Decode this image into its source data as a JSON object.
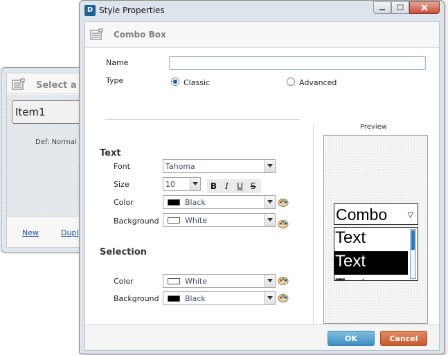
{
  "background_window": {
    "title": "Select a S",
    "list_item": "Item1",
    "default_text": "Def: Normal",
    "links": {
      "new": "New",
      "duplicate": "Dupl"
    }
  },
  "dialog": {
    "app_icon_label": "D",
    "title": "Style Properties",
    "header_title": "Combo Box",
    "name_label": "Name",
    "name_value": "",
    "type_label": "Type",
    "type_options": {
      "classic": "Classic",
      "advanced": "Advanced"
    },
    "type_selected": "Classic",
    "text_section": {
      "title": "Text",
      "font_label": "Font",
      "font_value": "Tahoma",
      "size_label": "Size",
      "size_value": "10",
      "style_buttons": {
        "bold": "B",
        "italic": "I",
        "underline": "U",
        "strike": "S"
      },
      "color_label": "Color",
      "color_value": "Black",
      "background_label": "Background",
      "background_value": "White"
    },
    "selection_section": {
      "title": "Selection",
      "color_label": "Color",
      "color_value": "White",
      "background_label": "Background",
      "background_value": "Black"
    },
    "preview": {
      "label": "Preview",
      "combo_text": "Combo",
      "combo_arrow": "▽",
      "rows": [
        "Text",
        "Text",
        "Text"
      ]
    },
    "buttons": {
      "ok": "OK",
      "cancel": "Cancel"
    }
  },
  "colors": {
    "black": "#000000",
    "white": "#ffffff",
    "ok_button": "#4a97c7",
    "cancel_button": "#cf6a3f",
    "radio_selected": "#1f5aa3"
  }
}
